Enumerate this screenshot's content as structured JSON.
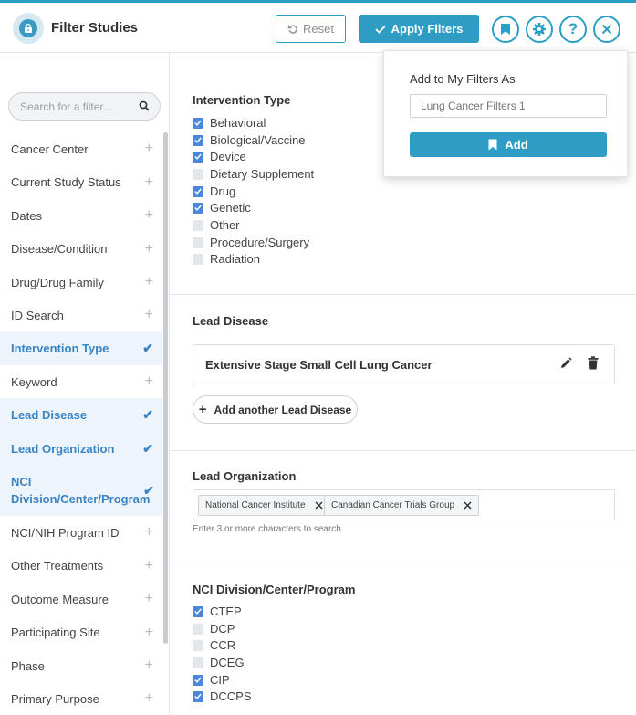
{
  "header": {
    "title": "Filter Studies",
    "reset_label": "Reset",
    "apply_label": "Apply Filters"
  },
  "sidebar": {
    "search_placeholder": "Search for a filter...",
    "items": [
      {
        "label": "Cancer Center",
        "active": false
      },
      {
        "label": "Current Study Status",
        "active": false
      },
      {
        "label": "Dates",
        "active": false
      },
      {
        "label": "Disease/Condition",
        "active": false
      },
      {
        "label": "Drug/Drug Family",
        "active": false
      },
      {
        "label": "ID Search",
        "active": false
      },
      {
        "label": "Intervention Type",
        "active": true
      },
      {
        "label": "Keyword",
        "active": false
      },
      {
        "label": "Lead Disease",
        "active": true
      },
      {
        "label": "Lead Organization",
        "active": true
      },
      {
        "label": "NCI Division/Center/Program",
        "active": true
      },
      {
        "label": "NCI/NIH Program ID",
        "active": false
      },
      {
        "label": "Other Treatments",
        "active": false
      },
      {
        "label": "Outcome Measure",
        "active": false
      },
      {
        "label": "Participating Site",
        "active": false
      },
      {
        "label": "Phase",
        "active": false
      },
      {
        "label": "Primary Purpose",
        "active": false
      }
    ]
  },
  "intervention": {
    "title": "Intervention Type",
    "options": [
      {
        "label": "Behavioral",
        "checked": true
      },
      {
        "label": "Biological/Vaccine",
        "checked": true
      },
      {
        "label": "Device",
        "checked": true
      },
      {
        "label": "Dietary Supplement",
        "checked": false
      },
      {
        "label": "Drug",
        "checked": true
      },
      {
        "label": "Genetic",
        "checked": true
      },
      {
        "label": "Other",
        "checked": false
      },
      {
        "label": "Procedure/Surgery",
        "checked": false
      },
      {
        "label": "Radiation",
        "checked": false
      }
    ]
  },
  "lead_disease": {
    "title": "Lead Disease",
    "value": "Extensive Stage Small Cell Lung Cancer",
    "add_label": "Add another Lead Disease"
  },
  "lead_org": {
    "title": "Lead Organization",
    "tags": [
      "National Cancer Institute",
      "Canadian Cancer Trials Group"
    ],
    "hint": "Enter 3 or more characters to search"
  },
  "nci_division": {
    "title": "NCI Division/Center/Program",
    "options": [
      {
        "label": "CTEP",
        "checked": true
      },
      {
        "label": "DCP",
        "checked": false
      },
      {
        "label": "CCR",
        "checked": false
      },
      {
        "label": "DCEG",
        "checked": false
      },
      {
        "label": "CIP",
        "checked": true
      },
      {
        "label": "DCCPS",
        "checked": true
      }
    ]
  },
  "popup": {
    "title": "Add to My Filters As",
    "input_placeholder": "Lung Cancer Filters 1",
    "add_label": "Add"
  }
}
